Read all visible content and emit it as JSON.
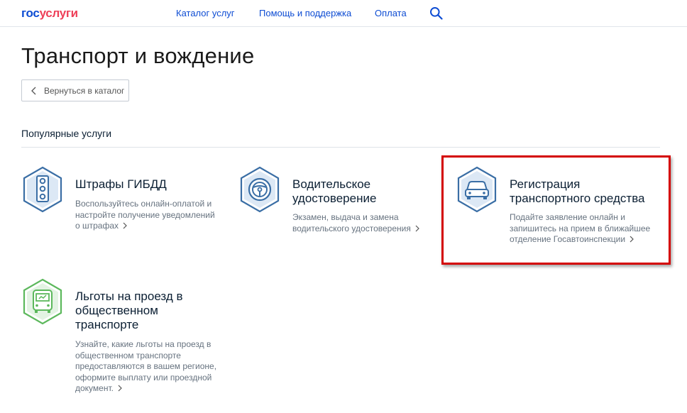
{
  "header": {
    "logo_part1": "гос",
    "logo_part2": "услуги",
    "nav": [
      {
        "label": "Каталог услуг"
      },
      {
        "label": "Помощь и поддержка"
      },
      {
        "label": "Оплата"
      }
    ],
    "search_icon": "search-icon"
  },
  "page": {
    "title": "Транспорт и вождение",
    "back_label": "Вернуться в каталог",
    "section_title": "Популярные услуги"
  },
  "cards": [
    {
      "title": "Штрафы ГИБДД",
      "desc": "Воспользуйтесь онлайн-оплатой и настройте получение уведомлений о штрафах",
      "icon": "traffic-light-icon",
      "color": "#3a6ea5"
    },
    {
      "title": "Водительское удостоверение",
      "desc": "Экзамен, выдача и замена водительского удостоверения",
      "icon": "steering-wheel-icon",
      "color": "#3a6ea5"
    },
    {
      "title": "Регистрация транспортного средства",
      "desc": "Подайте заявление онлайн и запишитесь на прием в ближайшее отделение Госавтоинспекции",
      "icon": "car-icon",
      "color": "#3a6ea5"
    },
    {
      "title": "Льготы на проезд в общественном транспорте",
      "desc": "Узнайте, какие льготы на проезд в общественном транспорте предоставляются в вашем регионе, оформите выплату или проездной документ.",
      "icon": "bus-icon",
      "color": "#5cb85c"
    }
  ],
  "colors": {
    "brand_blue": "#0d4cd3",
    "brand_red": "#ee3f58",
    "highlight": "#d40000"
  }
}
